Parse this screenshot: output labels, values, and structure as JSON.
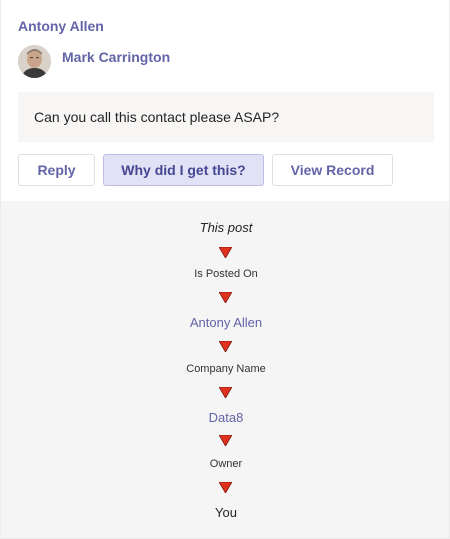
{
  "card": {
    "sender_name": "Antony Allen",
    "author_name": "Mark Carrington",
    "message": "Can you call this contact please ASAP?",
    "buttons": {
      "reply": "Reply",
      "why": "Why did I get this?",
      "view_record": "View Record"
    }
  },
  "explanation": {
    "steps": [
      "This post",
      "Is Posted On",
      "Antony Allen",
      "Company Name",
      "Data8",
      "Owner",
      "You"
    ],
    "arrow_color": "#e0301e",
    "link_color": "#6264a7"
  },
  "icons": {
    "arrow": "down-triangle-icon",
    "avatar": "user-avatar"
  }
}
